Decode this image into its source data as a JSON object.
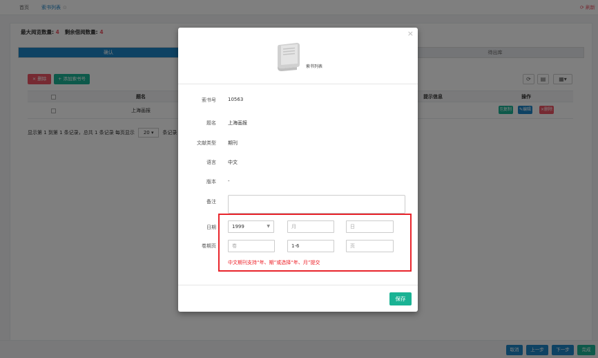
{
  "tabs": [
    {
      "label": "首页"
    },
    {
      "label": "索书列表",
      "close": "⊙"
    }
  ],
  "refresh_label": "刷新",
  "stats": {
    "max_label": "最大阅览数量:",
    "max_value": "4",
    "remain_label": "剩余借阅数量:",
    "remain_value": "4"
  },
  "steps": [
    {
      "label": "确认"
    },
    {
      "label": "待出库"
    }
  ],
  "toolbar": {
    "delete_label": "× 删除",
    "add_label": "+ 添加索书号"
  },
  "table": {
    "headers": {
      "title": "题名",
      "hint": "提示信息",
      "action": "操作"
    },
    "rows": [
      {
        "title": "上海画报",
        "copy": "复制",
        "edit": "编辑",
        "delete": "删除"
      }
    ]
  },
  "pager": {
    "text": "显示第 1 到第 1 条记录，总共 1 条记录  每页显示",
    "page_size": "20",
    "suffix": "条记录"
  },
  "bottom_buttons": {
    "cancel": "取消",
    "prev": "上一步",
    "next": "下一步",
    "finish": "完成"
  },
  "modal": {
    "close": "×",
    "title": "索书列表",
    "fields": {
      "callno_label": "索书号",
      "callno_value": "10563",
      "title_label": "题名",
      "title_value": "上海画报",
      "doctype_label": "文献类型",
      "doctype_value": "期刊",
      "lang_label": "语言",
      "lang_value": "中文",
      "edition_label": "版本",
      "edition_value": "-",
      "note_label": "备注"
    },
    "date": {
      "label": "日期",
      "year_value": "1999",
      "month_placeholder": "月",
      "day_placeholder": "日"
    },
    "volume": {
      "label": "卷期页",
      "vol_placeholder": "卷",
      "issue_value": "1-6",
      "page_placeholder": "页"
    },
    "warning": "中文期刊支持“年、期”或选择“年、月”提交",
    "save_label": "保存"
  },
  "colors": {
    "accent": "#1ab394",
    "primary": "#1c84c6",
    "danger": "#ed5565",
    "highlight": "#e8232a"
  }
}
